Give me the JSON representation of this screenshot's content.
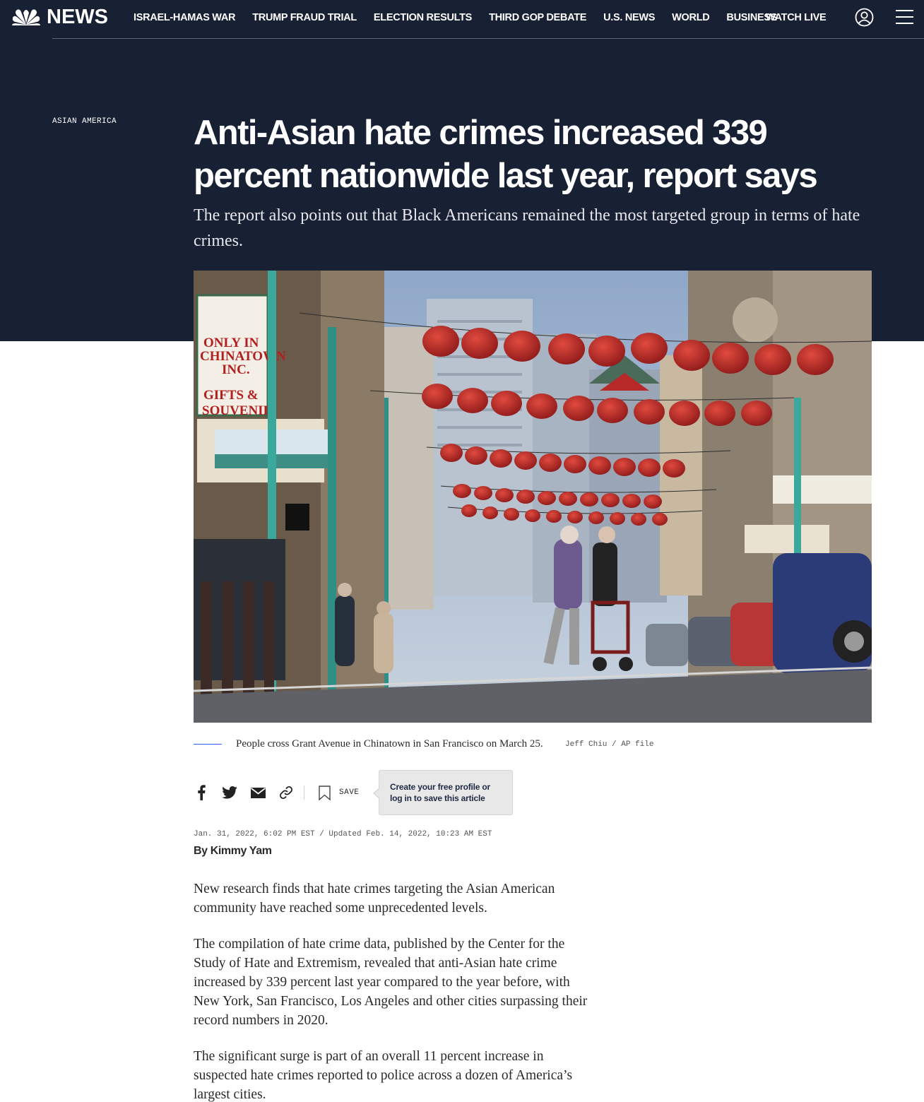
{
  "brand": {
    "name": "NEWS",
    "colors": {
      "hero_bg": "#182034",
      "accent_blue": "#3061ff"
    }
  },
  "nav": {
    "links": [
      "ISRAEL-HAMAS WAR",
      "TRUMP FRAUD TRIAL",
      "ELECTION RESULTS",
      "THIRD GOP DEBATE",
      "U.S. NEWS",
      "WORLD",
      "BUSINESS"
    ],
    "watch_live": "WATCH LIVE",
    "icons": {
      "profile": "user-circle-icon",
      "menu": "hamburger-menu-icon"
    }
  },
  "article": {
    "section": "ASIAN AMERICA",
    "headline": "Anti-Asian hate crimes increased 339 percent nationwide last year, report says",
    "dek": "The report also points out that Black Americans remained the most targeted group in terms of hate crimes.",
    "image": {
      "sign_text": [
        "ONLY IN",
        "CHINATOWN",
        "INC.",
        "GIFTS &",
        "SOUVENIR"
      ],
      "caption": "People cross Grant Avenue in Chinatown in San Francisco on March 25.",
      "credit": "Jeff Chiu / AP file"
    },
    "share": {
      "icons": [
        "facebook-icon",
        "twitter-icon",
        "email-icon",
        "link-icon"
      ],
      "save_label": "SAVE",
      "save_tooltip": "Create your free profile or log in to save this article"
    },
    "timestamp": "Jan. 31, 2022, 6:02 PM EST / Updated Feb. 14, 2022, 10:23 AM EST",
    "byline_prefix": "By",
    "author": "Kimmy Yam",
    "paragraphs": [
      "New research finds that hate crimes targeting the Asian American community have reached some unprecedented levels.",
      "The compilation of hate crime data, published by the Center for the Study of Hate and Extremism, revealed that anti-Asian hate crime increased by 339 percent last year compared to the year before, with New York, San Francisco, Los Angeles and other cities surpassing their record numbers in 2020.",
      "The significant surge is part of an overall 11 percent increase in suspected hate crimes reported to police across a dozen of America’s largest cities."
    ]
  }
}
